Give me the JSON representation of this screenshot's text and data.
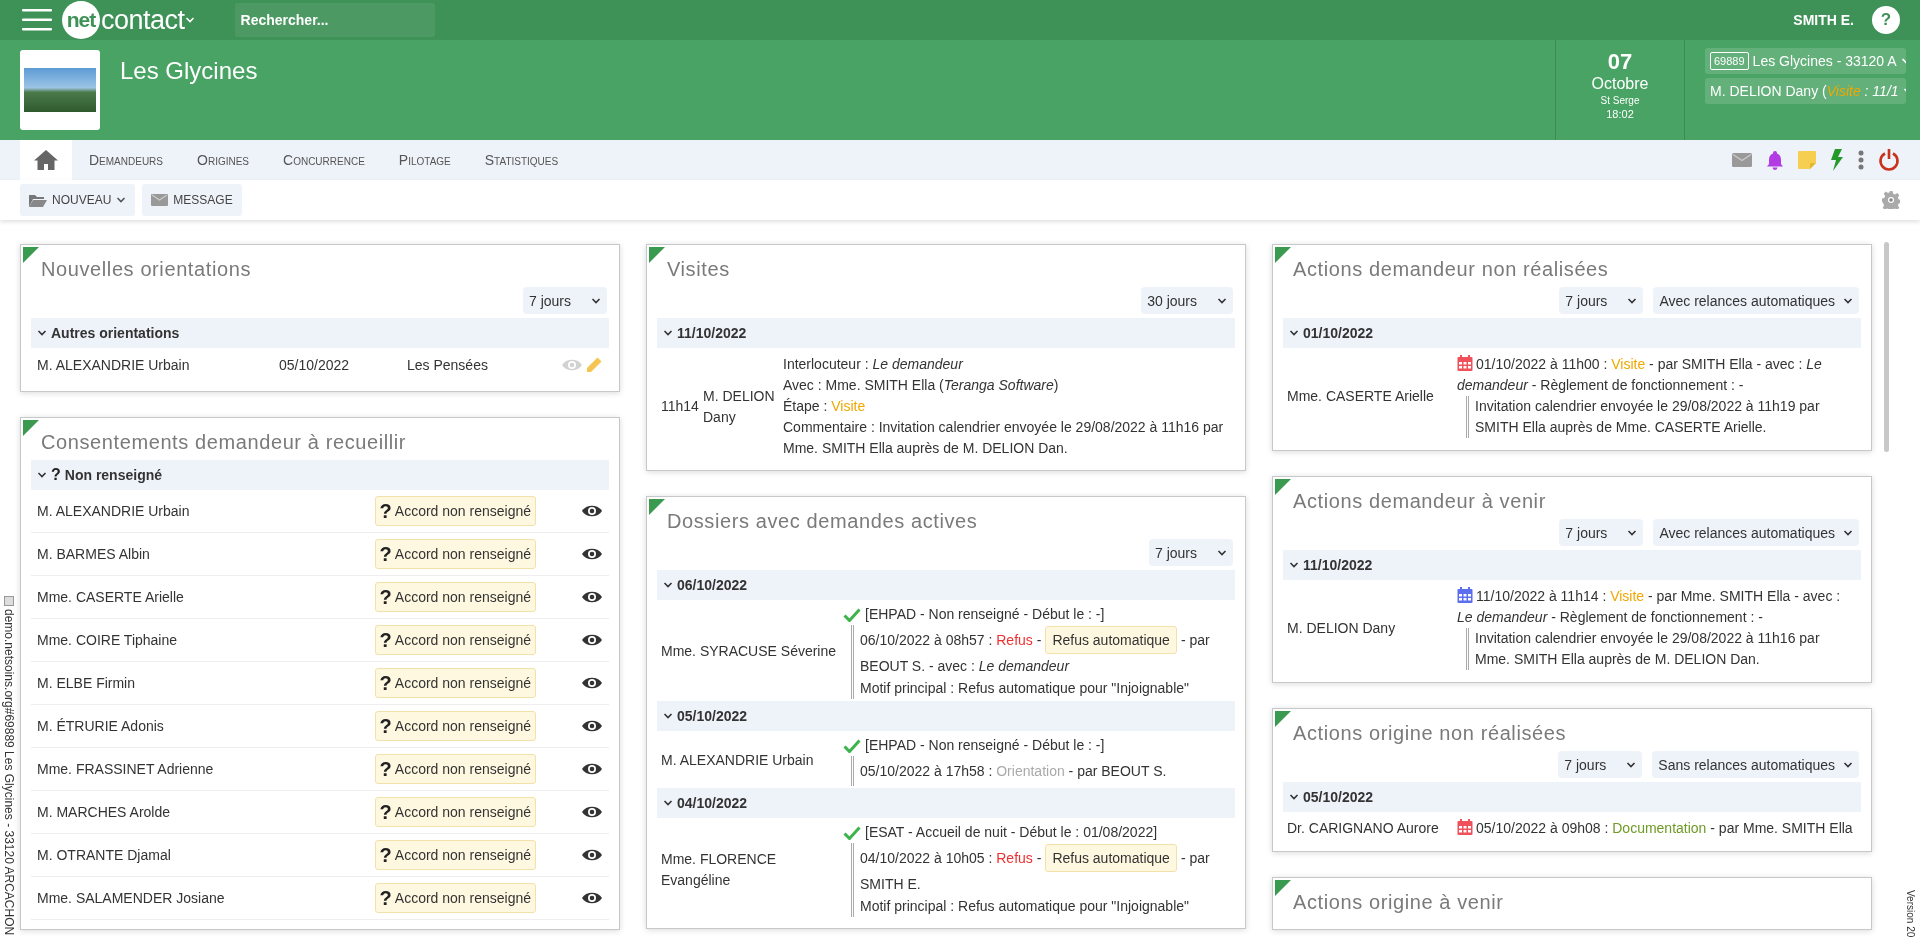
{
  "top_bar": {
    "logo": {
      "mark": "net",
      "name": "contact"
    },
    "search": {
      "placeholder": "Rechercher..."
    },
    "user": "SMITH E.",
    "help": "?"
  },
  "header": {
    "title": "Les Glycines",
    "date": {
      "day": "07",
      "month": "Octobre",
      "saint": "St Serge",
      "time": "18:02"
    },
    "site_select": {
      "code": "69889",
      "label": "Les Glycines - 33120 A"
    },
    "visit_select": {
      "person": "M. DELION Dany (",
      "step": {
        "kind": "visite",
        "label": "Visite"
      },
      "date": " : 11/1"
    }
  },
  "nav": {
    "tabs": [
      {
        "kind": "home",
        "selected": true
      },
      {
        "kind": "text",
        "label": "Demandeurs",
        "selected": false
      },
      {
        "kind": "text",
        "label": "Origines",
        "selected": false
      },
      {
        "kind": "text",
        "label": "Concurrence",
        "selected": false
      },
      {
        "kind": "text",
        "label": "Pilotage",
        "selected": false
      },
      {
        "kind": "text",
        "label": "Statistiques",
        "selected": false
      }
    ]
  },
  "toolbar": {
    "buttons": [
      {
        "kind": "folder",
        "label": "NOUVEAU",
        "dropdown": true
      },
      {
        "kind": "mail",
        "label": "MESSAGE",
        "dropdown": false
      }
    ]
  },
  "columns": [
    [
      {
        "kind": "orientations",
        "title": "Nouvelles orientations",
        "filters": [
          "7 jours"
        ],
        "groups": [
          {
            "label": "Autres orientations",
            "expanded": true,
            "rows": [
              {
                "name": "M. ALEXANDRIE Urbain",
                "date": "05/10/2022",
                "place": "Les Pensées"
              }
            ]
          }
        ]
      },
      {
        "kind": "consents",
        "title": "Consentements demandeur à recueillir",
        "groups": [
          {
            "icon": "?",
            "label": "Non renseigné",
            "expanded": true,
            "rows": [
              {
                "name": "M. ALEXANDRIE Urbain",
                "icon": "?",
                "status": "Accord non renseigné"
              },
              {
                "name": "M. BARMES Albin",
                "icon": "?",
                "status": "Accord non renseigné"
              },
              {
                "name": "Mme. CASERTE Arielle",
                "icon": "?",
                "status": "Accord non renseigné"
              },
              {
                "name": "Mme. COIRE Tiphaine",
                "icon": "?",
                "status": "Accord non renseigné"
              },
              {
                "name": "M. ELBE Firmin",
                "icon": "?",
                "status": "Accord non renseigné"
              },
              {
                "name": "M. ÉTRURIE Adonis",
                "icon": "?",
                "status": "Accord non renseigné"
              },
              {
                "name": "Mme. FRASSINET Adrienne",
                "icon": "?",
                "status": "Accord non renseigné"
              },
              {
                "name": "M. MARCHES Arolde",
                "icon": "?",
                "status": "Accord non renseigné"
              },
              {
                "name": "M. OTRANTE Djamal",
                "icon": "?",
                "status": "Accord non renseigné"
              },
              {
                "name": "Mme. SALAMENDER Josiane",
                "icon": "?",
                "status": "Accord non renseigné"
              }
            ]
          }
        ]
      }
    ],
    [
      {
        "kind": "visits",
        "title": "Visites",
        "filters": [
          "30 jours"
        ],
        "groups": [
          {
            "label": "11/10/2022",
            "expanded": true,
            "rows": [
              {
                "time": "11h14",
                "name": "M. DELION Dany",
                "interlocutor": "Interlocuteur : *Le demandeur*",
                "with": "Avec : Mme. SMITH Ella (*Teranga Software*)",
                "step_label": "Étape :",
                "step": {
                  "kind": "visite",
                  "label": "Visite"
                },
                "comment": "Commentaire : Invitation calendrier envoyée le 29/08/2022 à 11h16 par Mme. SMITH Ella auprès de M. DELION Dan."
              }
            ]
          }
        ]
      },
      {
        "kind": "dossiers",
        "title": "Dossiers avec demandes actives",
        "filters": [
          "7 jours"
        ],
        "groups": [
          {
            "label": "06/10/2022",
            "expanded": true,
            "rows": [
              {
                "name": "Mme. SYRACUSE Séverine",
                "request": "[EHPAD - Non renseigné - Début le : -]",
                "date": "06/10/2022 à 08h57 :",
                "status": {
                  "kind": "refus",
                  "label": "Refus"
                },
                "separator": "-",
                "badge": "Refus automatique",
                "by": "- par",
                "by_name": "BEOUT S. - avec : *Le demandeur*",
                "motif": "Motif principal : Refus automatique pour \"Injoignable\""
              }
            ]
          },
          {
            "label": "05/10/2022",
            "expanded": true,
            "rows": [
              {
                "name": "M. ALEXANDRIE Urbain",
                "request": "[EHPAD - Non renseigné - Début le : -]",
                "date": "05/10/2022 à 17h58 :",
                "status": {
                  "kind": "orientation",
                  "label": "Orientation"
                },
                "by": "- par BEOUT S."
              }
            ]
          },
          {
            "label": "04/10/2022",
            "expanded": true,
            "rows": [
              {
                "name": "Mme. FLORENCE Evangéline",
                "request": "[ESAT - Accueil de nuit - Début le : 01/08/2022]",
                "date": "04/10/2022 à 10h05 :",
                "status": {
                  "kind": "refus",
                  "label": "Refus"
                },
                "separator": "-",
                "badge": "Refus automatique",
                "by": "- par",
                "by_name": "SMITH E.",
                "motif": "Motif principal : Refus automatique pour \"Injoignable\""
              }
            ]
          }
        ]
      }
    ],
    [
      {
        "kind": "actions",
        "title": "Actions demandeur non réalisées",
        "filters": [
          "7 jours",
          "Avec relances automatiques"
        ],
        "groups": [
          {
            "label": "01/10/2022",
            "expanded": true,
            "rows": [
              {
                "name": "Mme. CASERTE Arielle",
                "color": "#f0505a",
                "date": "01/10/2022 à 11h00 :",
                "step": {
                  "kind": "visite",
                  "label": "Visite"
                },
                "details": "- par SMITH Ella - avec : *Le demandeur* - Règlement de fonctionnement : -",
                "note": "Invitation calendrier envoyée le 29/08/2022 à 11h19 par SMITH Ella auprès de Mme. CASERTE Arielle."
              }
            ]
          }
        ]
      },
      {
        "kind": "actions",
        "title": "Actions demandeur à venir",
        "filters": [
          "7 jours",
          "Avec relances automatiques"
        ],
        "groups": [
          {
            "label": "11/10/2022",
            "expanded": true,
            "rows": [
              {
                "name": "M. DELION Dany",
                "color": "#5b6ef0",
                "date": "11/10/2022 à 11h14 :",
                "step": {
                  "kind": "visite",
                  "label": "Visite"
                },
                "details": "- par Mme. SMITH Ella - avec : *Le demandeur* - Règlement de fonctionnement : -",
                "note": "Invitation calendrier envoyée le 29/08/2022 à 11h16 par Mme. SMITH Ella auprès de M. DELION Dan."
              }
            ]
          }
        ]
      },
      {
        "kind": "actions",
        "title": "Actions origine non réalisées",
        "filters": [
          "7 jours",
          "Sans relances automatiques"
        ],
        "groups": [
          {
            "label": "05/10/2022",
            "expanded": true,
            "rows": [
              {
                "name": "Dr. CARIGNANO Aurore",
                "color": "#f0505a",
                "date": "05/10/2022 à 09h08 :",
                "step": {
                  "kind": "documentation",
                  "label": "Documentation"
                },
                "details": "- par Mme. SMITH Ella"
              }
            ]
          }
        ]
      },
      {
        "title": "Actions origine à venir"
      }
    ]
  ],
  "side_info": "demo.netsoins.org#69889 Les Glycines - 33120 ARCACHON",
  "version": "Version 20"
}
